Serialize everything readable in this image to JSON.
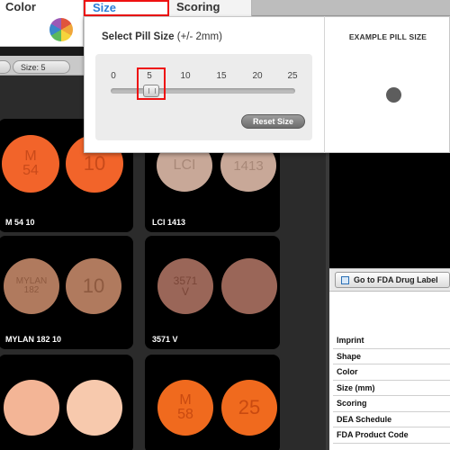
{
  "tabs": {
    "color_label": "Color",
    "size_label": "Size",
    "scoring_label": "Scoring"
  },
  "filter": {
    "size_chip": "Size: 5"
  },
  "size_popover": {
    "title": "Select Pill Size",
    "tolerance": "(+/- 2mm)",
    "ticks": [
      "0",
      "5",
      "10",
      "15",
      "20",
      "25"
    ],
    "selected_value": 5,
    "reset_label": "Reset Size",
    "example_label": "EXAMPLE PILL SIZE"
  },
  "pills": [
    {
      "caption": "M 54 10",
      "left_imprint": "M\n54",
      "right_imprint": "10",
      "color": "#f2642a"
    },
    {
      "caption": "LCI 1413",
      "left_imprint": "LCI",
      "right_imprint": "1413",
      "color": "#c8a898"
    },
    {
      "caption": "MYLAN 182 10",
      "left_imprint": "MYLAN\n182",
      "right_imprint": "10",
      "color": "#b07a5e"
    },
    {
      "caption": "3571 V",
      "left_imprint": "3571\nV",
      "right_imprint": "",
      "color": "#9a6658"
    },
    {
      "caption": "",
      "left_imprint": "",
      "right_imprint": "",
      "color": "#f3b596"
    },
    {
      "caption": "",
      "left_imprint": "M\n58",
      "right_imprint": "25",
      "color": "#f06a1e"
    }
  ],
  "detail": {
    "fda_button": "Go to FDA Drug Label",
    "rows": [
      "Imprint",
      "Shape",
      "Color",
      "Size (mm)",
      "Scoring",
      "DEA Schedule",
      "FDA Product Code"
    ]
  },
  "colors": {
    "accent_blue": "#2a7ed8",
    "highlight_red": "#ee1111"
  }
}
